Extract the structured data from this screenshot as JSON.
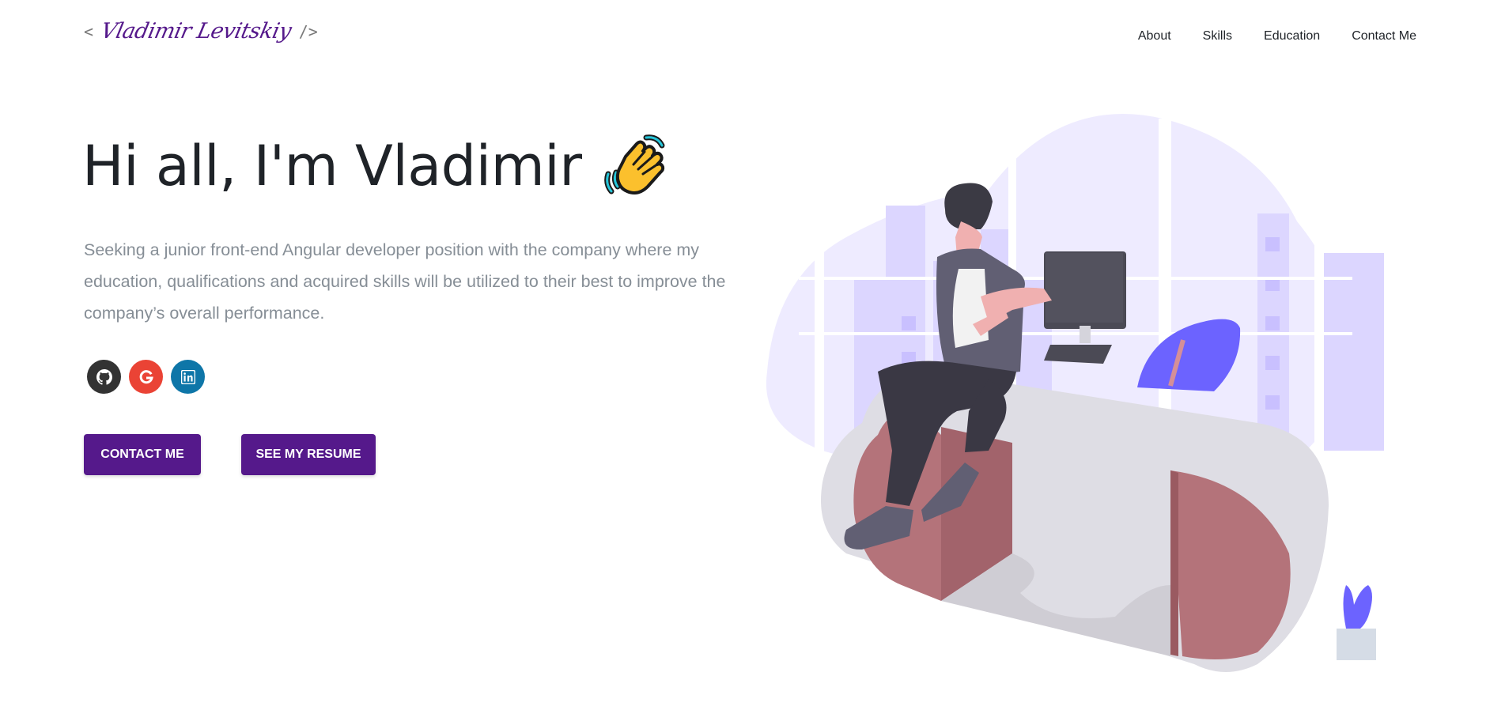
{
  "header": {
    "logo": {
      "open_bracket": "<",
      "name": "Vladimir Levitskiy",
      "close_bracket": "/>"
    },
    "nav": [
      {
        "label": "About"
      },
      {
        "label": "Skills"
      },
      {
        "label": "Education"
      },
      {
        "label": "Contact Me"
      }
    ]
  },
  "hero": {
    "greeting": "Hi all, I'm Vladimir",
    "wave_icon": "waving-hand-emoji",
    "subtitle": "Seeking a junior front-end Angular developer position with the company where my education, qualifications and acquired skills will be utilized to their best to improve the company’s overall performance.",
    "socials": [
      {
        "name": "github",
        "icon": "github-icon",
        "color": "#333333"
      },
      {
        "name": "google",
        "icon": "google-icon",
        "color": "#ea4335"
      },
      {
        "name": "linkedin",
        "icon": "linkedin-icon",
        "color": "#0e76a8"
      }
    ],
    "buttons": {
      "contact_label": "CONTACT ME",
      "resume_label": "SEE MY RESUME"
    }
  },
  "theme": {
    "accent": "#55198b",
    "illustration_accent": "#6c63ff"
  }
}
